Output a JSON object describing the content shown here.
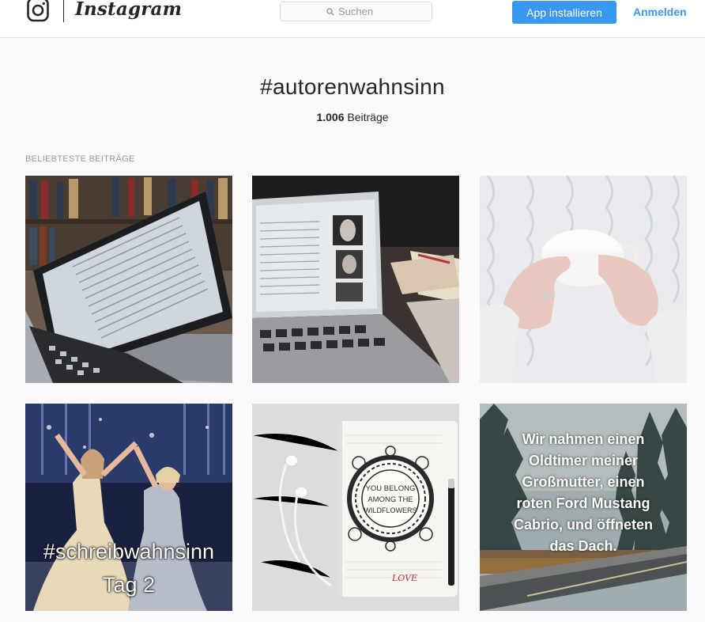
{
  "header": {
    "wordmark": "Instagram",
    "search_placeholder": "Suchen",
    "install_label": "App installieren",
    "login_label": "Anmelden"
  },
  "hashtag": {
    "title": "#autorenwahnsinn",
    "count": "1.006",
    "count_suffix": "Beiträge"
  },
  "section": {
    "label": "BELIEBTESTE BEITRÄGE"
  },
  "posts": [
    {
      "overlay": []
    },
    {
      "overlay": []
    },
    {
      "overlay": []
    },
    {
      "overlay": [
        "#schreibwahnsinn",
        "Tag 2"
      ]
    },
    {
      "overlay": [],
      "notebook_text": [
        "YOU BELONG",
        "AMONG THE",
        "WILDFLOWERS"
      ],
      "notebook_signature": "LOVE"
    },
    {
      "overlay": [
        "Wir nahmen einen",
        "Oldtimer meiner",
        "Großmutter, einen",
        "roten Ford Mustang",
        "Cabrio, und öffneten",
        "das Dach."
      ]
    }
  ],
  "colors": {
    "accent": "#3897f0",
    "text": "#262626",
    "muted": "#999999",
    "border": "#dbdbdb",
    "background": "#fafafa"
  }
}
